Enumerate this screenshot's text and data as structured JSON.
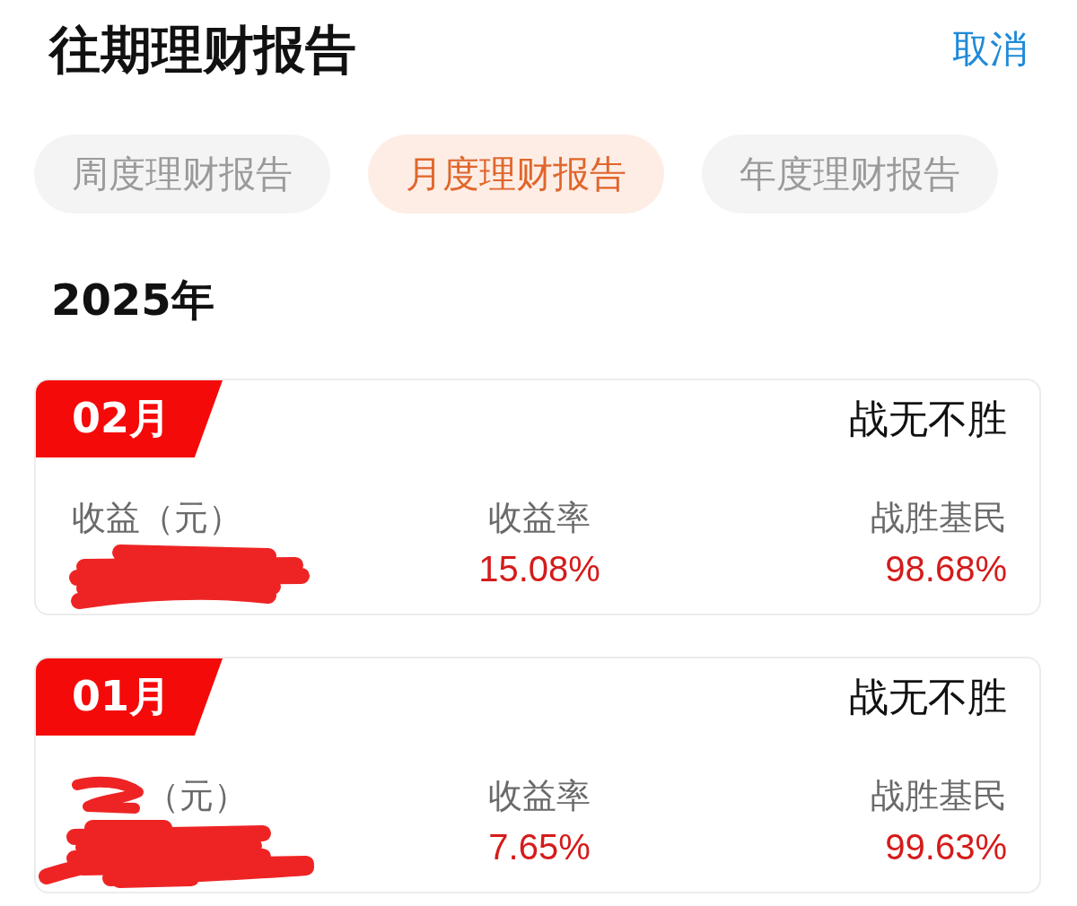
{
  "header": {
    "title": "往期理财报告",
    "cancel": "取消"
  },
  "tabs": [
    {
      "label": "周度理财报告",
      "selected": false
    },
    {
      "label": "月度理财报告",
      "selected": true
    },
    {
      "label": "年度理财报告",
      "selected": false
    }
  ],
  "year": "2025年",
  "reports": [
    {
      "month": "02月",
      "title": "战无不胜",
      "stats": [
        {
          "kind": "redacted",
          "label": "收益（元）",
          "label_covered": false
        },
        {
          "kind": "value",
          "label": "收益率",
          "value": "15.08%"
        },
        {
          "kind": "value",
          "label": "战胜基民",
          "value": "98.68%"
        }
      ]
    },
    {
      "month": "01月",
      "title": "战无不胜",
      "stats": [
        {
          "kind": "redacted",
          "label": "（元）",
          "label_covered": true
        },
        {
          "kind": "value",
          "label": "收益率",
          "value": "7.65%"
        },
        {
          "kind": "value",
          "label": "战胜基民",
          "value": "99.63%"
        }
      ]
    }
  ]
}
